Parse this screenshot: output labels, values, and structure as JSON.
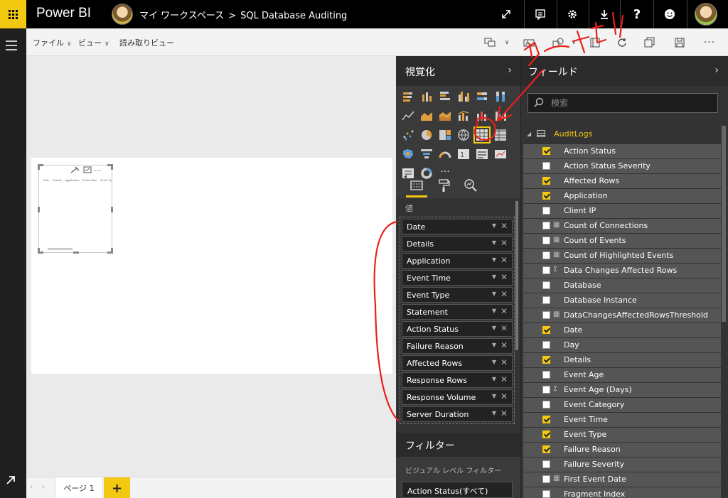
{
  "topbar": {
    "app_name": "Power BI",
    "workspace": "マイ ワークスペース",
    "separator": ">",
    "report_name": "SQL Database Auditing"
  },
  "menubar": {
    "file": "ファイル",
    "view": "ビュー",
    "reading_view": "読み取りビュー"
  },
  "canvas": {
    "visual_columns": [
      "Date",
      "Details",
      "Application",
      "Event Time",
      "Event Ty"
    ]
  },
  "pages": {
    "tab_label": "ページ 1",
    "add_label": "+"
  },
  "visualizations": {
    "title": "視覚化",
    "values_label": "値",
    "values": [
      "Date",
      "Details",
      "Application",
      "Event Time",
      "Event Type",
      "Statement",
      "Action Status",
      "Failure Reason",
      "Affected Rows",
      "Response Rows",
      "Response Volume",
      "Server Duration"
    ],
    "more_label": "···"
  },
  "filters": {
    "title": "フィルター",
    "visual_level": "ビジュアル レベル フィルター",
    "item": "Action Status(すべて)"
  },
  "fields": {
    "title": "フィールド",
    "search_placeholder": "検索",
    "table_name": "AuditLogs",
    "items": [
      {
        "name": "Action Status",
        "checked": true,
        "type": ""
      },
      {
        "name": "Action Status Severity",
        "checked": false,
        "type": ""
      },
      {
        "name": "Affected Rows",
        "checked": true,
        "type": ""
      },
      {
        "name": "Application",
        "checked": true,
        "type": ""
      },
      {
        "name": "Client IP",
        "checked": false,
        "type": ""
      },
      {
        "name": "Count of Connections",
        "checked": false,
        "type": "calc"
      },
      {
        "name": "Count of Events",
        "checked": false,
        "type": "calc"
      },
      {
        "name": "Count of Highlighted Events",
        "checked": false,
        "type": "calc"
      },
      {
        "name": "Data Changes Affected Rows",
        "checked": false,
        "type": "sum"
      },
      {
        "name": "Database",
        "checked": false,
        "type": ""
      },
      {
        "name": "Database Instance",
        "checked": false,
        "type": ""
      },
      {
        "name": "DataChangesAffectedRowsThreshold",
        "checked": false,
        "type": "calc"
      },
      {
        "name": "Date",
        "checked": true,
        "type": ""
      },
      {
        "name": "Day",
        "checked": false,
        "type": ""
      },
      {
        "name": "Details",
        "checked": true,
        "type": ""
      },
      {
        "name": "Event Age",
        "checked": false,
        "type": ""
      },
      {
        "name": "Event Age (Days)",
        "checked": false,
        "type": "sum"
      },
      {
        "name": "Event Category",
        "checked": false,
        "type": ""
      },
      {
        "name": "Event Time",
        "checked": true,
        "type": ""
      },
      {
        "name": "Event Type",
        "checked": true,
        "type": ""
      },
      {
        "name": "Failure Reason",
        "checked": true,
        "type": ""
      },
      {
        "name": "Failure Severity",
        "checked": false,
        "type": ""
      },
      {
        "name": "First Event Date",
        "checked": false,
        "type": "calc"
      },
      {
        "name": "Fragment Index",
        "checked": false,
        "type": ""
      }
    ]
  },
  "annotation": {
    "handwritten_text": "テーブル",
    "color": "#e8201a"
  },
  "colors": {
    "accent": "#f2c811",
    "topbar": "#000000",
    "pane": "#333333"
  }
}
